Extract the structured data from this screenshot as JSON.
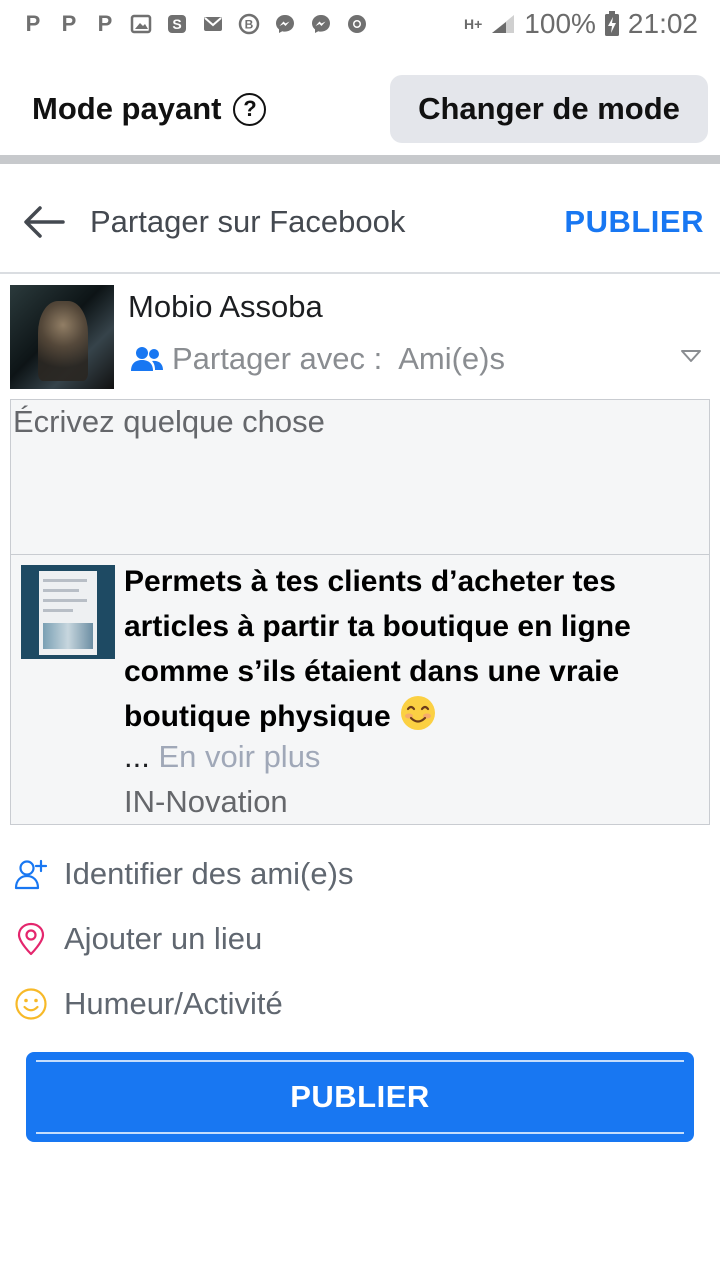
{
  "status_bar": {
    "left_icons": [
      "p-icon",
      "p-icon",
      "p-icon",
      "image-icon",
      "skype-icon",
      "mail-icon",
      "b-icon",
      "messenger-icon",
      "messenger-icon",
      "chrome-icon"
    ],
    "network": "H+",
    "battery": "100%",
    "time": "21:02"
  },
  "mode_bar": {
    "title": "Mode payant",
    "help_glyph": "?",
    "change_button": "Changer de mode"
  },
  "header": {
    "title": "Partager sur Facebook",
    "publish": "PUBLIER"
  },
  "author": {
    "name": "Mobio Assoba",
    "share_label": "Partager avec :",
    "share_value": "Ami(e)s"
  },
  "composer": {
    "placeholder": "Écrivez quelque chose"
  },
  "attachment": {
    "text": "Permets à tes clients d’acheter tes articles à partir ta boutique en ligne comme s’ils étaient dans une vraie boutique physique",
    "ellipsis": "...",
    "see_more": "En voir plus",
    "source": "IN-Novation"
  },
  "actions": [
    {
      "label": "Identifier des ami(e)s",
      "icon": "tag-friends-icon"
    },
    {
      "label": "Ajouter un lieu",
      "icon": "location-icon"
    },
    {
      "label": "Humeur/Activité",
      "icon": "smiley-icon"
    }
  ],
  "publish_button": "PUBLIER",
  "colors": {
    "accent": "#1877f2",
    "tag_icon": "#1877f2",
    "location_icon": "#e4266d",
    "mood_icon": "#f7b928"
  }
}
